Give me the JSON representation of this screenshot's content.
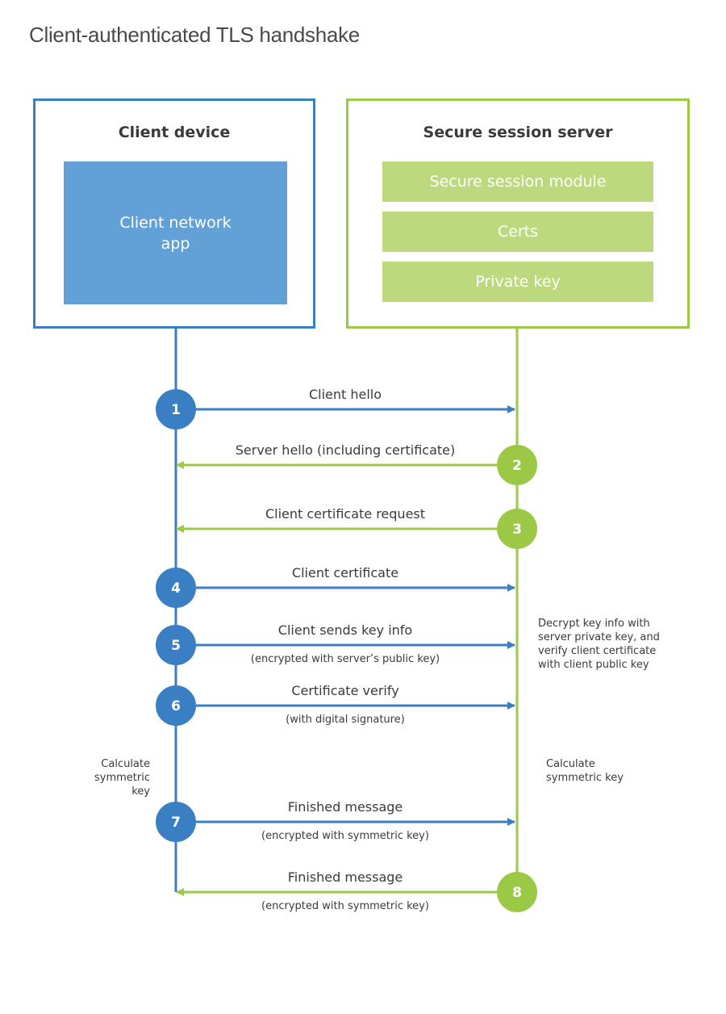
{
  "title": "Client-authenticated TLS handshake",
  "colors": {
    "client": "#3a7fc4",
    "client_block": "#63a0d6",
    "server": "#9cc945",
    "server_block": "#bcd97e"
  },
  "client": {
    "heading": "Client device",
    "component": "Client network app"
  },
  "server": {
    "heading": "Secure session server",
    "components": [
      "Secure session module",
      "Certs",
      "Private key"
    ]
  },
  "steps": [
    {
      "number": "1",
      "label": "Client hello",
      "sub": "",
      "direction": "client-to-server"
    },
    {
      "number": "2",
      "label": "Server hello (including certificate)",
      "sub": "",
      "direction": "server-to-client"
    },
    {
      "number": "3",
      "label": "Client certificate request",
      "sub": "",
      "direction": "server-to-client"
    },
    {
      "number": "4",
      "label": "Client certificate",
      "sub": "",
      "direction": "client-to-server"
    },
    {
      "number": "5",
      "label": "Client sends key info",
      "sub": "(encrypted with server’s public key)",
      "direction": "client-to-server"
    },
    {
      "number": "6",
      "label": "Certificate verify",
      "sub": "(with digital signature)",
      "direction": "client-to-server"
    },
    {
      "number": "7",
      "label": "Finished message",
      "sub": "(encrypted with symmetric key)",
      "direction": "client-to-server"
    },
    {
      "number": "8",
      "label": "Finished message",
      "sub": "(encrypted with symmetric key)",
      "direction": "server-to-client"
    }
  ],
  "notes": {
    "server_decrypt": "Decrypt key info with server private key, and verify client certificate with client public key",
    "client_calc": "Calculate symmetric key",
    "server_calc": "Calculate symmetric key"
  }
}
